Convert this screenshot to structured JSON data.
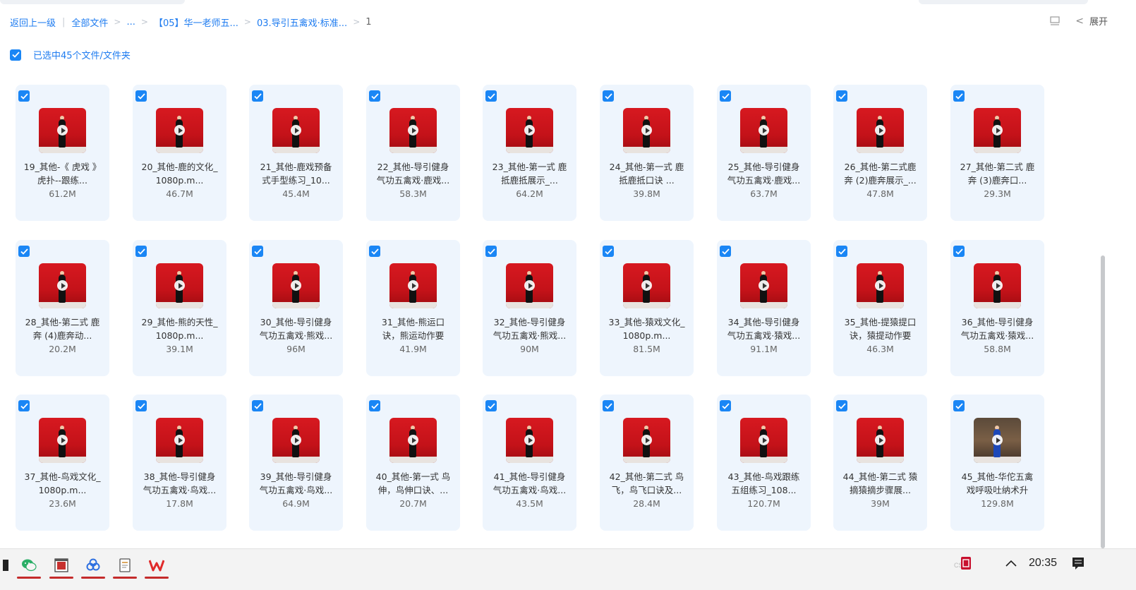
{
  "breadcrumb": {
    "back": "返回上一级",
    "all_files": "全部文件",
    "ellipsis": "...",
    "folder1": "【05】华一老师五...",
    "folder2": "03.导引五禽戏·标准...",
    "current": "1"
  },
  "toolbar": {
    "expand_label": "展开"
  },
  "selection": {
    "text": "已选中45个文件/文件夹"
  },
  "files": [
    {
      "line1": "19_其他-《 虎戏 》",
      "line2": "虎扑--跟练...",
      "size": "61.2M",
      "thumb": "red"
    },
    {
      "line1": "20_其他-鹿的文化_",
      "line2": "1080p.m...",
      "size": "46.7M",
      "thumb": "red"
    },
    {
      "line1": "21_其他-鹿戏预备",
      "line2": "式手型练习_10...",
      "size": "45.4M",
      "thumb": "red"
    },
    {
      "line1": "22_其他-导引健身",
      "line2": "气功五禽戏·鹿戏...",
      "size": "58.3M",
      "thumb": "red"
    },
    {
      "line1": "23_其他-第一式 鹿",
      "line2": "抵鹿抵展示_...",
      "size": "64.2M",
      "thumb": "red"
    },
    {
      "line1": "24_其他-第一式 鹿",
      "line2": "抵鹿抵口诀 ...",
      "size": "39.8M",
      "thumb": "red"
    },
    {
      "line1": "25_其他-导引健身",
      "line2": "气功五禽戏·鹿戏...",
      "size": "63.7M",
      "thumb": "red"
    },
    {
      "line1": "26_其他-第二式鹿",
      "line2": "奔 (2)鹿奔展示_...",
      "size": "47.8M",
      "thumb": "red"
    },
    {
      "line1": "27_其他-第二式 鹿",
      "line2": "奔 (3)鹿奔口...",
      "size": "29.3M",
      "thumb": "red"
    },
    {
      "line1": "28_其他-第二式 鹿",
      "line2": "奔 (4)鹿奔动...",
      "size": "20.2M",
      "thumb": "red"
    },
    {
      "line1": "29_其他-熊的天性_",
      "line2": "1080p.m...",
      "size": "39.1M",
      "thumb": "red"
    },
    {
      "line1": "30_其他-导引健身",
      "line2": "气功五禽戏·熊戏...",
      "size": "96M",
      "thumb": "red"
    },
    {
      "line1": "31_其他-熊运口",
      "line2": "诀，熊运动作要",
      "size": "41.9M",
      "thumb": "red"
    },
    {
      "line1": "32_其他-导引健身",
      "line2": "气功五禽戏·熊戏...",
      "size": "90M",
      "thumb": "red"
    },
    {
      "line1": "33_其他-猿戏文化_",
      "line2": "1080p.m...",
      "size": "81.5M",
      "thumb": "red"
    },
    {
      "line1": "34_其他-导引健身",
      "line2": "气功五禽戏·猿戏...",
      "size": "91.1M",
      "thumb": "red"
    },
    {
      "line1": "35_其他-提猿提口",
      "line2": "诀，猿提动作要",
      "size": "46.3M",
      "thumb": "red"
    },
    {
      "line1": "36_其他-导引健身",
      "line2": "气功五禽戏·猿戏...",
      "size": "58.8M",
      "thumb": "red"
    },
    {
      "line1": "37_其他-鸟戏文化_",
      "line2": "1080p.m...",
      "size": "23.6M",
      "thumb": "red"
    },
    {
      "line1": "38_其他-导引健身",
      "line2": "气功五禽戏·鸟戏...",
      "size": "17.8M",
      "thumb": "red"
    },
    {
      "line1": "39_其他-导引健身",
      "line2": "气功五禽戏·鸟戏...",
      "size": "64.9M",
      "thumb": "red"
    },
    {
      "line1": "40_其他-第一式 鸟",
      "line2": "伸，鸟伸口诀、...",
      "size": "20.7M",
      "thumb": "red"
    },
    {
      "line1": "41_其他-导引健身",
      "line2": "气功五禽戏·鸟戏...",
      "size": "43.5M",
      "thumb": "red"
    },
    {
      "line1": "42_其他-第二式 鸟",
      "line2": "飞，鸟飞口诀及...",
      "size": "28.4M",
      "thumb": "red"
    },
    {
      "line1": "43_其他-鸟戏跟练",
      "line2": "五组练习_108...",
      "size": "120.7M",
      "thumb": "red"
    },
    {
      "line1": "44_其他-第二式 猿",
      "line2": "摘猿摘步骤展...",
      "size": "39M",
      "thumb": "red"
    },
    {
      "line1": "45_其他-华佗五禽",
      "line2": "戏呼吸吐纳术升",
      "size": "129.8M",
      "thumb": "alt"
    }
  ],
  "taskbar": {
    "clock": "20:35",
    "items": [
      "app-icon",
      "wechat-icon",
      "window-icon",
      "network-icon",
      "notepad-icon",
      "wps-icon"
    ]
  },
  "colors": {
    "accent": "#1f7cf0",
    "card_bg": "#eef5fd",
    "checkbox": "#1a86f5"
  }
}
